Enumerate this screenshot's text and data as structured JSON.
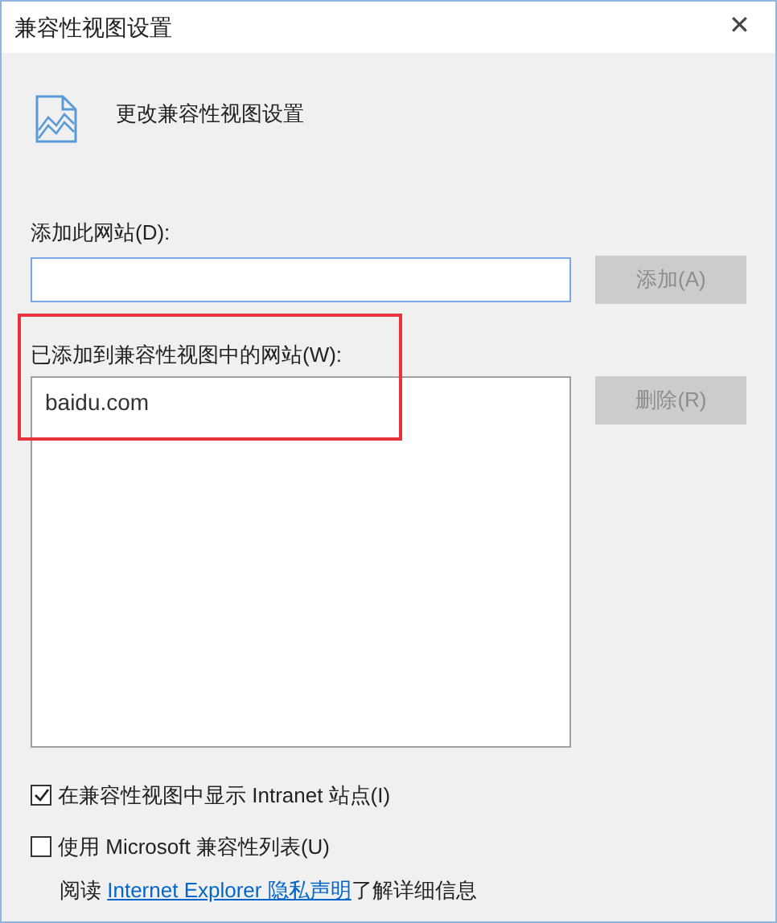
{
  "window": {
    "title": "兼容性视图设置",
    "close": "✕"
  },
  "header": {
    "text": "更改兼容性视图设置"
  },
  "add_site": {
    "label": "添加此网站(D):",
    "button": {
      "label": "添加(A)",
      "disabled": true
    }
  },
  "sites": {
    "label": "已添加到兼容性视图中的网站(W):",
    "highlighted": true,
    "items": [
      {
        "text": "baidu.com",
        "selected": false
      }
    ],
    "button": {
      "label": "删除(R)",
      "disabled": true
    }
  },
  "options": [
    {
      "label": "在兼容性视图中显示 Intranet 站点(I)",
      "checked": true
    },
    {
      "label": "使用 Microsoft 兼容性列表(U)",
      "checked": false
    }
  ],
  "footer": {
    "before": "阅读 ",
    "link": "Internet Explorer 隐私声明",
    "after": "了解详细信息"
  }
}
